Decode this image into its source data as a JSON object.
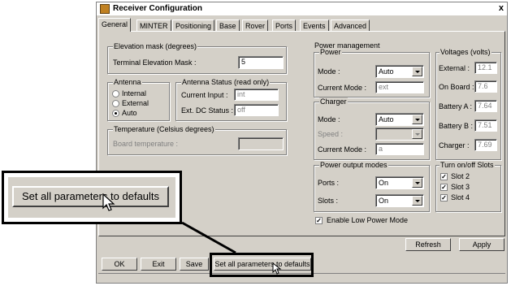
{
  "window": {
    "title": "Receiver Configuration",
    "close": "x"
  },
  "tabs": [
    "General",
    "MINTER",
    "Positioning",
    "Base",
    "Rover",
    "Ports",
    "Events",
    "Advanced"
  ],
  "elevation": {
    "legend": "Elevation mask (degrees)",
    "label": "Terminal Elevation Mask :",
    "value": "5"
  },
  "antenna": {
    "legend": "Antenna",
    "options": [
      "Internal",
      "External",
      "Auto"
    ]
  },
  "antenna_status": {
    "legend": "Antenna Status (read only)",
    "current_input_label": "Current Input :",
    "current_input_value": "int",
    "ext_dc_label": "Ext. DC Status :",
    "ext_dc_value": "off"
  },
  "temperature": {
    "legend": "Temperature (Celsius degrees)",
    "label": "Board temperature :",
    "value": ""
  },
  "power_management": {
    "legend": "Power management"
  },
  "power": {
    "legend": "Power",
    "mode_label": "Mode :",
    "mode_value": "Auto",
    "current_mode_label": "Current Mode :",
    "current_mode_value": "ext"
  },
  "charger": {
    "legend": "Charger",
    "mode_label": "Mode :",
    "mode_value": "Auto",
    "speed_label": "Speed :",
    "speed_value": "",
    "current_mode_label": "Current Mode :",
    "current_mode_value": "a"
  },
  "voltages": {
    "legend": "Voltages (volts)",
    "external_label": "External :",
    "external_value": "12.1",
    "onboard_label": "On Board :",
    "onboard_value": "7.6",
    "battery_a_label": "Battery A :",
    "battery_a_value": "7.64",
    "battery_b_label": "Battery B :",
    "battery_b_value": "7.51",
    "charger_label": "Charger :",
    "charger_value": "7.69"
  },
  "power_output": {
    "legend": "Power output modes",
    "ports_label": "Ports :",
    "ports_value": "On",
    "slots_label": "Slots :",
    "slots_value": "On"
  },
  "slots": {
    "legend": "Turn on/off Slots",
    "items": [
      "Slot 2",
      "Slot 3",
      "Slot 4"
    ]
  },
  "low_power": {
    "label": "Enable Low Power Mode"
  },
  "buttons": {
    "refresh": "Refresh",
    "apply": "Apply",
    "ok": "OK",
    "exit": "Exit",
    "save": "Save",
    "defaults": "Set all parameters to defaults"
  },
  "callout": {
    "label": "Set all parameters to defaults"
  }
}
